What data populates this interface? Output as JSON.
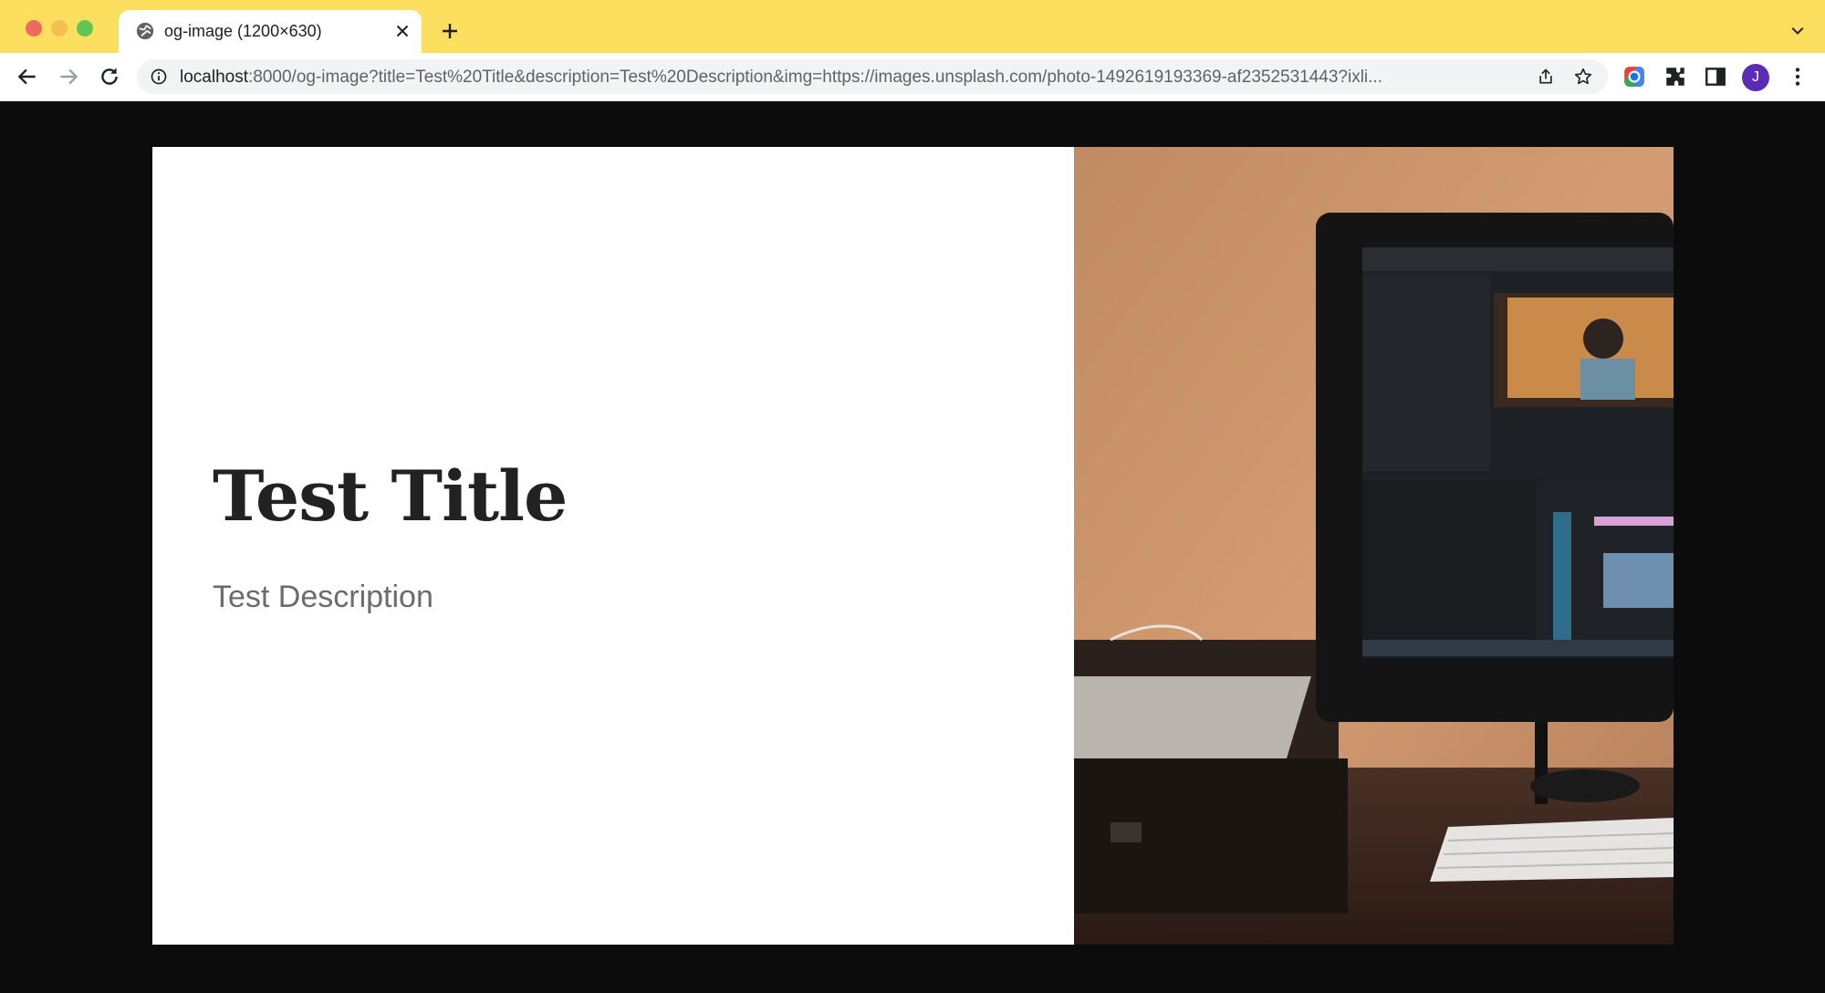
{
  "browser": {
    "tab_title": "og-image (1200×630)",
    "url_host": "localhost",
    "url_rest": ":8000/og-image?title=Test%20Title&description=Test%20Description&img=https://images.unsplash.com/photo-1492619193369-af2352531443?ixli...",
    "profile_initial": "J",
    "theme_color": "#fddf60"
  },
  "og_card": {
    "title": "Test Title",
    "description": "Test Description"
  },
  "icons": {
    "favicon": "globe-icon",
    "close": "close-icon",
    "new_tab": "plus-icon",
    "back": "back-arrow-icon",
    "forward": "forward-arrow-icon",
    "reload": "reload-icon",
    "info": "info-icon",
    "share": "share-icon",
    "bookmark": "star-icon",
    "extension": "puzzle-icon",
    "side_panel": "side-panel-icon",
    "menu": "kebab-menu-icon"
  }
}
